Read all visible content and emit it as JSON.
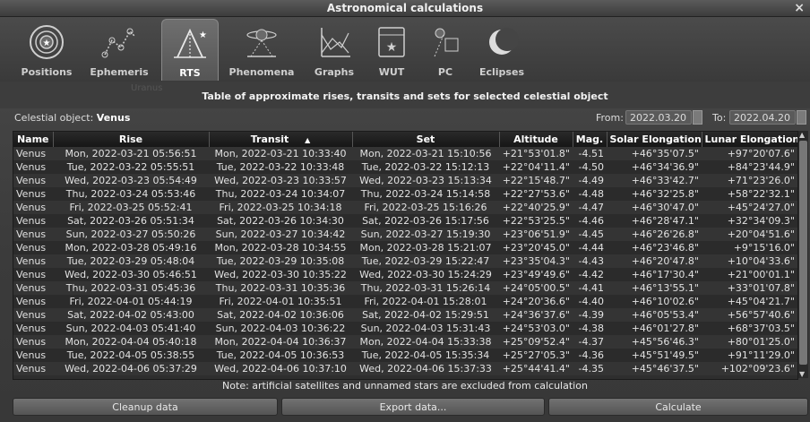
{
  "window": {
    "title": "Astronomical calculations",
    "close_glyph": "×"
  },
  "tabs": [
    {
      "label": "Positions",
      "icon": "positions-icon"
    },
    {
      "label": "Ephemeris",
      "icon": "ephemeris-icon"
    },
    {
      "label": "RTS",
      "icon": "rts-icon",
      "active": true
    },
    {
      "label": "Phenomena",
      "icon": "phenomena-icon"
    },
    {
      "label": "Graphs",
      "icon": "graphs-icon"
    },
    {
      "label": "WUT",
      "icon": "wut-icon"
    },
    {
      "label": "PC",
      "icon": "pc-icon"
    },
    {
      "label": "Eclipses",
      "icon": "eclipses-icon"
    }
  ],
  "ghost_text": "Uranus",
  "heading": "Table of approximate rises, transits and sets for selected celestial object",
  "object": {
    "label": "Celestial object:",
    "value": "Venus"
  },
  "range": {
    "from_label": "From:",
    "from": "2022.03.20",
    "to_label": "To:",
    "to": "2022.04.20"
  },
  "table": {
    "columns": [
      "Name",
      "Rise",
      "Transit",
      "Set",
      "Altitude",
      "Mag.",
      "Solar Elongation",
      "Lunar Elongation"
    ],
    "sort_indicator": "▲",
    "rows": [
      [
        "Venus",
        "Mon, 2022-03-21 05:56:51",
        "Mon, 2022-03-21 10:33:40",
        "Mon, 2022-03-21 15:10:56",
        "+21°53'01.8\"",
        "-4.51",
        "+46°35'07.5\"",
        "+97°20'07.6\""
      ],
      [
        "Venus",
        "Tue, 2022-03-22 05:55:51",
        "Tue, 2022-03-22 10:33:48",
        "Tue, 2022-03-22 15:12:13",
        "+22°04'11.4\"",
        "-4.50",
        "+46°34'36.9\"",
        "+84°23'44.9\""
      ],
      [
        "Venus",
        "Wed, 2022-03-23 05:54:49",
        "Wed, 2022-03-23 10:33:57",
        "Wed, 2022-03-23 15:13:34",
        "+22°15'48.7\"",
        "-4.49",
        "+46°33'42.7\"",
        "+71°23'26.0\""
      ],
      [
        "Venus",
        "Thu, 2022-03-24 05:53:46",
        "Thu, 2022-03-24 10:34:07",
        "Thu, 2022-03-24 15:14:58",
        "+22°27'53.6\"",
        "-4.48",
        "+46°32'25.8\"",
        "+58°22'32.1\""
      ],
      [
        "Venus",
        "Fri, 2022-03-25 05:52:41",
        "Fri, 2022-03-25 10:34:18",
        "Fri, 2022-03-25 15:16:26",
        "+22°40'25.9\"",
        "-4.47",
        "+46°30'47.0\"",
        "+45°24'27.0\""
      ],
      [
        "Venus",
        "Sat, 2022-03-26 05:51:34",
        "Sat, 2022-03-26 10:34:30",
        "Sat, 2022-03-26 15:17:56",
        "+22°53'25.5\"",
        "-4.46",
        "+46°28'47.1\"",
        "+32°34'09.3\""
      ],
      [
        "Venus",
        "Sun, 2022-03-27 05:50:26",
        "Sun, 2022-03-27 10:34:42",
        "Sun, 2022-03-27 15:19:30",
        "+23°06'51.9\"",
        "-4.45",
        "+46°26'26.8\"",
        "+20°04'51.6\""
      ],
      [
        "Venus",
        "Mon, 2022-03-28 05:49:16",
        "Mon, 2022-03-28 10:34:55",
        "Mon, 2022-03-28 15:21:07",
        "+23°20'45.0\"",
        "-4.44",
        "+46°23'46.8\"",
        "+9°15'16.0\""
      ],
      [
        "Venus",
        "Tue, 2022-03-29 05:48:04",
        "Tue, 2022-03-29 10:35:08",
        "Tue, 2022-03-29 15:22:47",
        "+23°35'04.3\"",
        "-4.43",
        "+46°20'47.8\"",
        "+10°04'33.6\""
      ],
      [
        "Venus",
        "Wed, 2022-03-30 05:46:51",
        "Wed, 2022-03-30 10:35:22",
        "Wed, 2022-03-30 15:24:29",
        "+23°49'49.6\"",
        "-4.42",
        "+46°17'30.4\"",
        "+21°00'01.1\""
      ],
      [
        "Venus",
        "Thu, 2022-03-31 05:45:36",
        "Thu, 2022-03-31 10:35:36",
        "Thu, 2022-03-31 15:26:14",
        "+24°05'00.5\"",
        "-4.41",
        "+46°13'55.1\"",
        "+33°01'07.8\""
      ],
      [
        "Venus",
        "Fri, 2022-04-01 05:44:19",
        "Fri, 2022-04-01 10:35:51",
        "Fri, 2022-04-01 15:28:01",
        "+24°20'36.6\"",
        "-4.40",
        "+46°10'02.6\"",
        "+45°04'21.7\""
      ],
      [
        "Venus",
        "Sat, 2022-04-02 05:43:00",
        "Sat, 2022-04-02 10:36:06",
        "Sat, 2022-04-02 15:29:51",
        "+24°36'37.6\"",
        "-4.39",
        "+46°05'53.4\"",
        "+56°57'40.6\""
      ],
      [
        "Venus",
        "Sun, 2022-04-03 05:41:40",
        "Sun, 2022-04-03 10:36:22",
        "Sun, 2022-04-03 15:31:43",
        "+24°53'03.0\"",
        "-4.38",
        "+46°01'27.8\"",
        "+68°37'03.5\""
      ],
      [
        "Venus",
        "Mon, 2022-04-04 05:40:18",
        "Mon, 2022-04-04 10:36:37",
        "Mon, 2022-04-04 15:33:38",
        "+25°09'52.4\"",
        "-4.37",
        "+45°56'46.3\"",
        "+80°01'25.0\""
      ],
      [
        "Venus",
        "Tue, 2022-04-05 05:38:55",
        "Tue, 2022-04-05 10:36:53",
        "Tue, 2022-04-05 15:35:34",
        "+25°27'05.3\"",
        "-4.36",
        "+45°51'49.5\"",
        "+91°11'29.0\""
      ],
      [
        "Venus",
        "Wed, 2022-04-06 05:37:29",
        "Wed, 2022-04-06 10:37:10",
        "Wed, 2022-04-06 15:37:33",
        "+25°44'41.4\"",
        "-4.35",
        "+45°46'37.5\"",
        "+102°09'23.6\""
      ]
    ]
  },
  "note": "Note: artificial satellites and unnamed stars are excluded from calculation",
  "buttons": {
    "cleanup": "Cleanup data",
    "export": "Export data...",
    "calculate": "Calculate"
  },
  "colors": {
    "background": "#3a3a3a",
    "header": "#1e1e1e",
    "text": "#e6e6e6"
  }
}
